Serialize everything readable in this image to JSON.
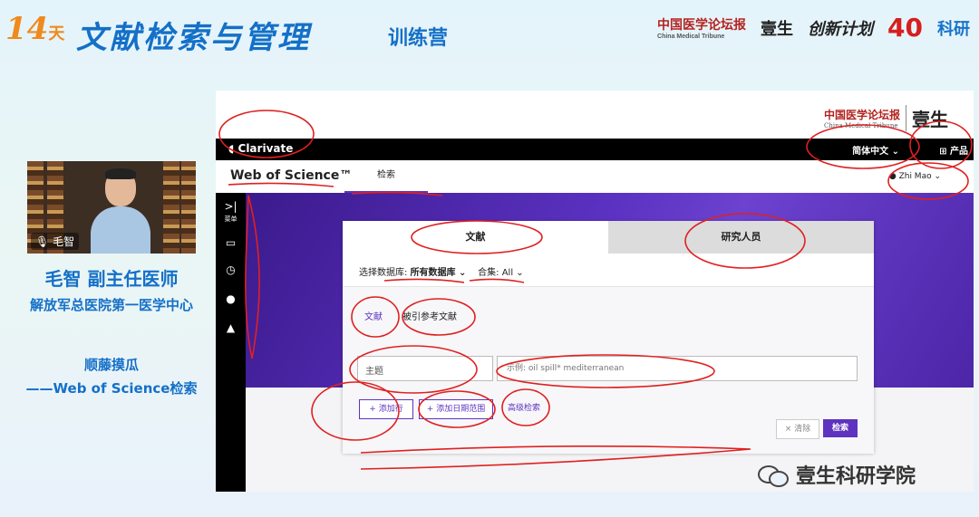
{
  "banner": {
    "days_num": "14",
    "days_unit": "天",
    "title": "文献检索与管理",
    "subtitle": "训练营",
    "sponsors": {
      "cmt_cn": "中国医学论坛报",
      "cmt_en": "China Medical Tribune",
      "yisheng": "壹生",
      "chuangxin": "创新计划",
      "forty": "40",
      "keyan": "科研"
    }
  },
  "speaker": {
    "video_label": "毛智",
    "name_title": "毛智 副主任医师",
    "organization": "解放军总医院第一医学中心",
    "topic_line1": "顺藤摸瓜",
    "topic_line2": "——Web of Science检索"
  },
  "wos": {
    "cmt_logo_cn": "中国医学论坛报",
    "cmt_logo_en": "China Medical Tribune",
    "cmt_logo_yisheng": "壹生",
    "clarivate": "Clarivate",
    "language": "简体中文 ⌄",
    "products": "⊞ 产品",
    "logo": "Web of Science™",
    "tab_search": "检索",
    "user": "Zhi Mao ⌄",
    "nav_menu_label": "菜单",
    "tabs": {
      "documents": "文献",
      "researchers": "研究人员"
    },
    "database_label": "选择数据库:",
    "database_value": "所有数据库 ⌄",
    "collection_label": "合集:",
    "collection_value": "All ⌄",
    "subtab_documents": "文献",
    "subtab_cited": "被引参考文献",
    "field_select": "主题",
    "search_placeholder": "示例: oil spill* mediterranean",
    "add_row": "+ 添加行",
    "add_date": "+ 添加日期范围",
    "advanced": "高级检索",
    "clear": "× 清除",
    "search_button": "检索"
  },
  "watermark": {
    "text": "壹生科研学院"
  },
  "colors": {
    "brand_purple": "#5e33bf",
    "banner_blue": "#1470c8",
    "annotation_red": "#e02020"
  }
}
